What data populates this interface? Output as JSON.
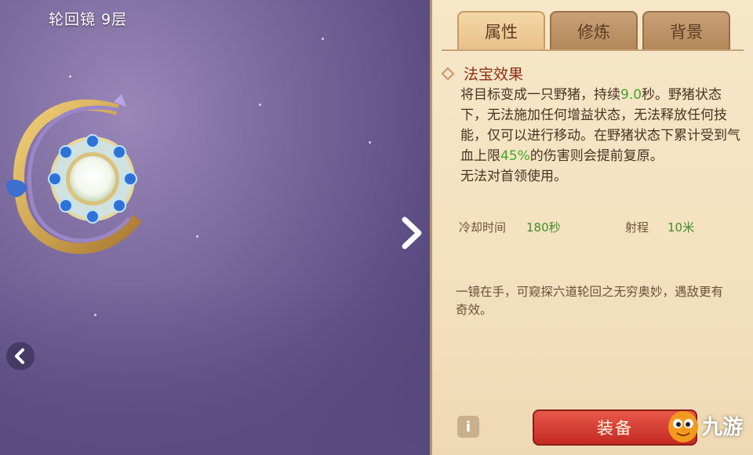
{
  "item": {
    "title": "轮回镜 9层"
  },
  "tabs": [
    {
      "label": "属性",
      "active": true
    },
    {
      "label": "修炼",
      "active": false
    },
    {
      "label": "背景",
      "active": false
    }
  ],
  "effect": {
    "section_title": "法宝效果",
    "desc_parts": [
      "将目标变成一只野猪，持续",
      "9.0",
      "秒。野猪状态下，无法施加任何增益状态，无法释放任何技能，仅可以进行移动。在野猪状态下累计受到气血上限",
      "45%",
      "的伤害则会提前复原。"
    ],
    "line2": "无法对首领使用。"
  },
  "stats": {
    "cooldown_label": "冷却时间",
    "cooldown_value": "180秒",
    "range_label": "射程",
    "range_value": "10米"
  },
  "flavor": "一镜在手，可窥探六道轮回之无穷奥妙，遇敌更有奇效。",
  "buttons": {
    "info": "i",
    "equip": "装备"
  },
  "watermark": {
    "text": "九游"
  },
  "colors": {
    "highlight": "#46a62a",
    "section_title": "#8c2f14",
    "equip_button": "#d63b30"
  },
  "icons": [
    "chevron-right-icon",
    "chevron-left-icon",
    "info-icon",
    "diamond-icon"
  ]
}
